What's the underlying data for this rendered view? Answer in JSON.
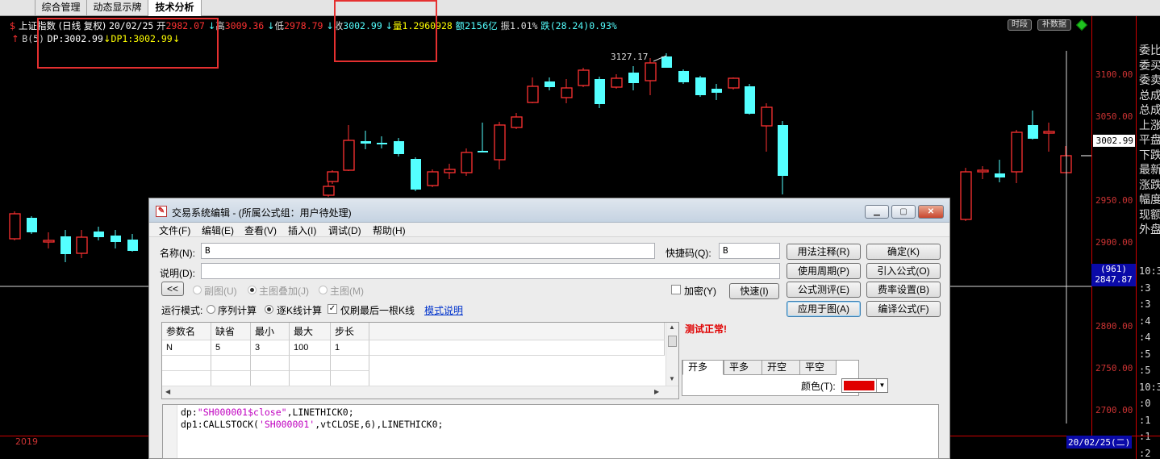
{
  "tabs": [
    "综合管理",
    "动态显示牌",
    "技术分析"
  ],
  "chart": {
    "indicator_icon": "$",
    "info": {
      "name": "上证指数",
      "period": "(日线 复权)",
      "date": "20/02/25",
      "open_label": "开",
      "open": "2982.07",
      "high_label": "高",
      "high": "3009.36",
      "low_label": "低",
      "low": "2978.79",
      "close_label": "收",
      "close": "3002.99",
      "vol_label": "量",
      "vol": "1.2960928",
      "amount_label": "额",
      "amount": "2156亿",
      "amp_label": "振",
      "amp": "1.01%",
      "change_label": "跌",
      "change": "(28.24)",
      "change_pct": "0.93%"
    },
    "indicator_line": {
      "name": "B(5)",
      "dp_label": "DP:",
      "dp": "3002.99",
      "dp1_label": "DP1:",
      "dp1": "3002.99"
    },
    "peak_label": "3127.17",
    "btn_shiduan": "时段",
    "btn_bushuju": "补数据",
    "y_ticks": [
      "3100.00",
      "3050.00",
      "3002.99",
      "2950.00",
      "2900.00",
      "2800.00",
      "2750.00",
      "2700.00"
    ],
    "current_price": "3002.99",
    "cross_count": "(961)",
    "cross_value": "2847.87",
    "year": "2019",
    "date_label": "20/02/25(二)",
    "colors": {
      "up": "#ff3232",
      "down": "#54ffff",
      "price_axis": "#cc3333"
    }
  },
  "right_panel": {
    "labels": [
      "委比",
      "委买",
      "委卖",
      "总成",
      "总成",
      "上涨",
      "平盘",
      "下跌",
      "最新",
      "涨跌",
      "幅度",
      "现额",
      "外盘"
    ],
    "times": [
      "10:3",
      ":3",
      ":3",
      ":4",
      ":4",
      ":5",
      ":5",
      "10:3",
      ":0",
      ":1",
      ":1",
      ":2"
    ]
  },
  "dialog": {
    "title": "交易系统编辑 - (所属公式组：用户待处理)",
    "menus": [
      "文件(F)",
      "编辑(E)",
      "查看(V)",
      "插入(I)",
      "调试(D)",
      "帮助(H)"
    ],
    "name_label": "名称(N):",
    "name_value": "B",
    "shortcut_label": "快捷码(Q):",
    "shortcut_value": "B",
    "desc_label": "说明(D):",
    "desc_value": "",
    "collapse_btn": "<<",
    "radio_subchart": "副图(U)",
    "radio_overlay": "主图叠加(J)",
    "radio_main": "主图(M)",
    "encrypt_label": "加密(Y)",
    "quick_btn": "快速(I)",
    "mode_label": "运行模式:",
    "mode_seq": "序列计算",
    "mode_kline": "逐K线计算",
    "only_last_label": "仅刷最后一根K线",
    "mode_help_link": "模式说明",
    "buttons": {
      "usage": "用法注释(R)",
      "ok": "确定(K)",
      "period": "使用周期(P)",
      "import": "引入公式(O)",
      "test": "公式测评(E)",
      "fee": "费率设置(B)",
      "apply": "应用于图(A)",
      "compile": "编译公式(F)"
    },
    "params": {
      "headers": [
        "参数名",
        "缺省",
        "最小",
        "最大",
        "步长"
      ],
      "rows": [
        [
          "N",
          "5",
          "3",
          "100",
          "1"
        ]
      ]
    },
    "test_message": "测试正常!",
    "signal_tabs": [
      "开多",
      "平多",
      "开空",
      "平空"
    ],
    "color_label": "颜色(T):",
    "color_value": "#e00000",
    "code": {
      "line1_a": "dp:",
      "line1_str": "\"SH000001$close\"",
      "line1_b": ",LINETHICK0;",
      "line2_a": "dp1:CALLSTOCK(",
      "line2_str": "'SH000001'",
      "line2_b": ",vtCLOSE,6),LINETHICK0;"
    }
  }
}
